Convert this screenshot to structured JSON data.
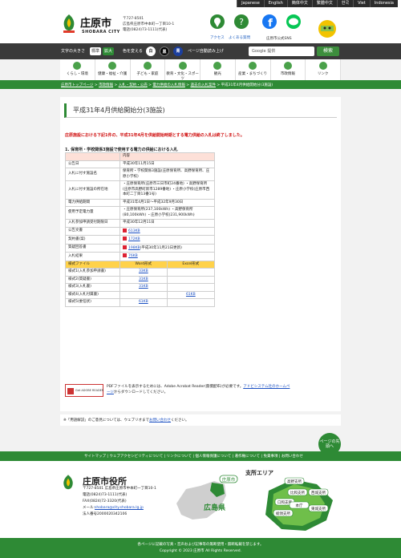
{
  "languages": [
    "Japanese",
    "English",
    "簡体中文",
    "繁體中文",
    "한국",
    "Viet",
    "Indonesia"
  ],
  "header": {
    "city_name": "庄原市",
    "city_en": "SHOBARA CITY",
    "postal": "〒727-8501",
    "address": "広島県庄原市中本町一丁目10-1",
    "phone": "電話(0824)73-1111(代表)",
    "access_label": "アクセス",
    "faq_label": "よくある質問",
    "sns_label": "庄原市公式SNS"
  },
  "toolbar": {
    "font_size_label": "文字の大きさ",
    "standard": "標準",
    "enlarge": "拡大",
    "color_label": "色を変える",
    "white": "白",
    "black": "黒",
    "blue": "青",
    "autoread": "ページ自動読み上げ",
    "search_placeholder": "Google 提供",
    "search_button": "検索"
  },
  "gnav": [
    "くらし・環境",
    "健康・福祉・介護",
    "子ども・家庭",
    "教育・文化・スポーツ",
    "観光",
    "産業・まちづくり",
    "市政情報",
    "リンク"
  ],
  "breadcrumb": {
    "items": [
      "庄原市トップページ",
      "市政情報",
      "入札・契約・公売",
      "電力供給の入札情報",
      "過去の入札案件"
    ],
    "current": "平成31年4月供給開始分(3施設)",
    "sep": " > "
  },
  "page": {
    "title": "平成31年4月供給開始分(3施設)",
    "notice": "庄原施設における下記1件の、平成31年4月を供給開始時期とする電力供給の入札は終了しました。",
    "section": "1. 保育所・学校関係3施設で使用する電力の供給における入札"
  },
  "table": {
    "content_header": "内容",
    "rows": [
      {
        "k": "公告日",
        "v": "平成30年11月15日"
      },
      {
        "k": "入札に付す施設名",
        "v": "保育所・学校関係3施設(庄原保育所、高野保育所、庄原小学校)"
      },
      {
        "k": "入札に付す施設の所在地",
        "v": "・庄原保育所(庄原市三日市町24番地) ・高野保育所(庄原市高野町新市1289番地) ・庄原小学校(庄原市西本町二丁目13番1号)"
      },
      {
        "k": "電力供給期間",
        "v": "平成31年4月1日〜平成32年9月30日"
      },
      {
        "k": "使用予定電力量",
        "v": "・庄原保育所(237,100kWh) ・高野保育所(80,100kWh) ・庄原小学校(231,900kWh)"
      },
      {
        "k": "入札参加申請受付期限日",
        "v": "平成30年12月11日"
      }
    ],
    "docs": [
      {
        "k": "公告文書",
        "link": "613KB",
        "extra": ""
      },
      {
        "k": "契約書(案)",
        "link": "172KB",
        "extra": ""
      },
      {
        "k": "質疑回答書",
        "link": "198KB",
        "extra": "(平成30年11月21日更新)"
      },
      {
        "k": "入札結果",
        "link": "76KB",
        "extra": ""
      }
    ],
    "forms_header": [
      "様式ファイル",
      "Word形式",
      "Excel形式"
    ],
    "forms": [
      {
        "k": "様式1(入札参加申請書)",
        "word": "33KB",
        "excel": ""
      },
      {
        "k": "様式2(質疑書)",
        "word": "31KB",
        "excel": ""
      },
      {
        "k": "様式3(入札書)",
        "word": "31KB",
        "excel": ""
      },
      {
        "k": "様式4(入札付属書)",
        "word": "",
        "excel": "61KB"
      },
      {
        "k": "様式5(委任状)",
        "word": "61KB",
        "excel": ""
      }
    ]
  },
  "adobe": {
    "badge": "Get ADOBE READER",
    "text1": "PDFファイルを表示するためには、Adobe Acrobat Reader(無償配布)が必要です。",
    "link": "アドビシステム社のホームページ",
    "text2": "からダウンロードしてください。"
  },
  "footnote": {
    "text": "※「用語解説」のご意見については、ウェブリオまで",
    "link": "お問い合わせ",
    "tail": "ください。"
  },
  "pagetop": "ページの先頭へ",
  "footer_nav": [
    "サイトマップ",
    "ウェブアクセシビリティについて",
    "リンクについて",
    "個人情報保護について",
    "著作権について",
    "免責事項",
    "お問い合わせ"
  ],
  "footer": {
    "title": "庄原市役所",
    "address": "〒727-8501 広島県庄原市中本町一丁目10-1",
    "tel": "電話(0824)73-1111(代表)",
    "fax": "FAX(0824)72-3320(代表)",
    "mail_label": "メール:",
    "mail": "shobara@city.shobara.lg.jp",
    "corp": "法人番号2000020342106",
    "map_city": "庄原市",
    "map_pref": "広島県",
    "area_title": "支所エリア",
    "areas": [
      "高野支所",
      "比和支所",
      "西城支所",
      "口和支所",
      "東城支所",
      "総領支所",
      "本庁"
    ]
  },
  "copyright": {
    "line1": "各ページに記載の写真・音声および記事等の無断使用・無断転載を禁じます。",
    "line2": "Copyright © 2023 庄原市 All Rights Reserved."
  },
  "colors": {
    "brand_green": "#2e8a35",
    "notice_red": "#d01010",
    "link_blue": "#1a4fc2"
  }
}
